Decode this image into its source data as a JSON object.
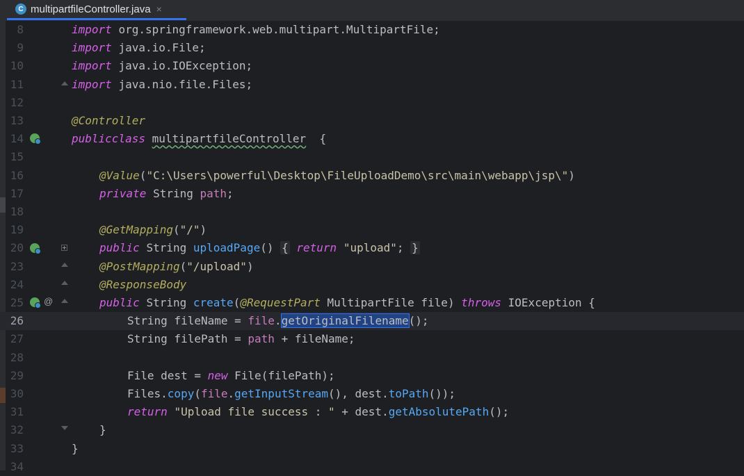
{
  "tab": {
    "filename": "multipartfileController.java",
    "icon": "C",
    "close": "×"
  },
  "lines": [
    {
      "n": "8",
      "pieces": [
        [
          "pkw",
          "import"
        ],
        [
          "",
          "org.springframework.web.multipart.MultipartFile;"
        ]
      ]
    },
    {
      "n": "9",
      "pieces": [
        [
          "pkw",
          "import"
        ],
        [
          "",
          "java.io.File;"
        ]
      ]
    },
    {
      "n": "10",
      "pieces": [
        [
          "pkw",
          "import"
        ],
        [
          "",
          "java.io.IOException;"
        ]
      ]
    },
    {
      "n": "11",
      "pieces": [
        [
          "pkw",
          "import"
        ],
        [
          "",
          "java.nio.file.Files;"
        ]
      ]
    },
    {
      "n": "12",
      "pieces": []
    },
    {
      "n": "13",
      "pieces": [
        [
          "anno",
          "@Controller"
        ]
      ]
    },
    {
      "n": "14",
      "pieces": [
        [
          "pkw",
          "public"
        ],
        [
          "",
          "",
          ""
        ],
        [
          "pkw",
          "class"
        ],
        [
          "squig",
          "multipartfileController"
        ],
        [
          "",
          " {"
        ]
      ]
    },
    {
      "n": "15",
      "pieces": []
    },
    {
      "n": "16",
      "pieces": [
        [
          "anno",
          "@Value"
        ],
        [
          "",
          "("
        ],
        [
          "strx",
          "\"C:\\Users\\powerful\\Desktop\\FileUploadDemo\\src\\main\\webapp\\jsp\\\""
        ],
        [
          "",
          ")"
        ]
      ]
    },
    {
      "n": "17",
      "pieces": [
        [
          "pkw",
          "private"
        ],
        [
          "",
          "String"
        ],
        [
          "field",
          "path"
        ],
        [
          "",
          ";"
        ]
      ]
    },
    {
      "n": "18",
      "pieces": []
    },
    {
      "n": "19",
      "pieces": [
        [
          "anno",
          "@GetMapping"
        ],
        [
          "",
          "("
        ],
        [
          "strx",
          "\"/\""
        ],
        [
          "",
          ")"
        ]
      ]
    },
    {
      "n": "20",
      "pieces": [
        [
          "pkw",
          "public"
        ],
        [
          "",
          "String"
        ],
        [
          "meth",
          "uploadPage"
        ],
        [
          "",
          "()"
        ],
        [
          "fold-box",
          "{"
        ],
        [
          "pkw",
          "return"
        ],
        [
          "strx",
          "\"upload\""
        ],
        [
          "",
          ";"
        ],
        [
          "fold-box",
          "}"
        ]
      ]
    },
    {
      "n": "23",
      "pieces": [
        [
          "anno",
          "@PostMapping"
        ],
        [
          "",
          "("
        ],
        [
          "strx",
          "\"/upload\""
        ],
        [
          "",
          ")"
        ]
      ]
    },
    {
      "n": "24",
      "pieces": [
        [
          "anno",
          "@ResponseBody"
        ]
      ]
    },
    {
      "n": "25",
      "pieces": [
        [
          "pkw",
          "public"
        ],
        [
          "",
          "String"
        ],
        [
          "meth",
          "create"
        ],
        [
          "",
          "("
        ],
        [
          "anno",
          "@RequestPart"
        ],
        [
          "",
          "MultipartFile file)"
        ],
        [
          "pkw",
          "throws"
        ],
        [
          "",
          "IOException {"
        ]
      ]
    },
    {
      "n": "26",
      "pieces": [
        [
          "",
          "String fileName ="
        ],
        [
          "field",
          "file"
        ],
        [
          "",
          "."
        ],
        [
          "sel",
          "getOriginalFilename"
        ],
        [
          "",
          "();"
        ]
      ]
    },
    {
      "n": "27",
      "pieces": [
        [
          "",
          "String filePath ="
        ],
        [
          "field",
          "path"
        ],
        [
          "",
          "+ fileName;"
        ]
      ]
    },
    {
      "n": "28",
      "pieces": []
    },
    {
      "n": "29",
      "pieces": [
        [
          "",
          "File dest ="
        ],
        [
          "pkw",
          "new"
        ],
        [
          "",
          "File(filePath);"
        ]
      ]
    },
    {
      "n": "30",
      "pieces": [
        [
          "",
          "Files."
        ],
        [
          "meth",
          "copy"
        ],
        [
          "",
          "("
        ],
        [
          "field",
          "file"
        ],
        [
          "",
          "."
        ],
        [
          "meth",
          "getInputStream"
        ],
        [
          "",
          "(), dest."
        ],
        [
          "meth",
          "toPath"
        ],
        [
          "",
          "());"
        ]
      ]
    },
    {
      "n": "31",
      "pieces": [
        [
          "pkw",
          "return"
        ],
        [
          "strx",
          "\"Upload file success : \""
        ],
        [
          "",
          "+ dest."
        ],
        [
          "meth",
          "getAbsolutePath"
        ],
        [
          "",
          "();"
        ]
      ]
    },
    {
      "n": "32",
      "pieces": [
        [
          "",
          "}"
        ]
      ]
    },
    {
      "n": "33",
      "pieces": [
        [
          "",
          "}"
        ]
      ]
    },
    {
      "n": "34",
      "pieces": []
    }
  ],
  "colors": {
    "background": "#1e1f22",
    "keyword": "#d561e9",
    "annotation": "#b3ae60",
    "string": "#c9c3a9",
    "method": "#56a8f5",
    "field": "#c77dbb",
    "selection": "#214283"
  }
}
